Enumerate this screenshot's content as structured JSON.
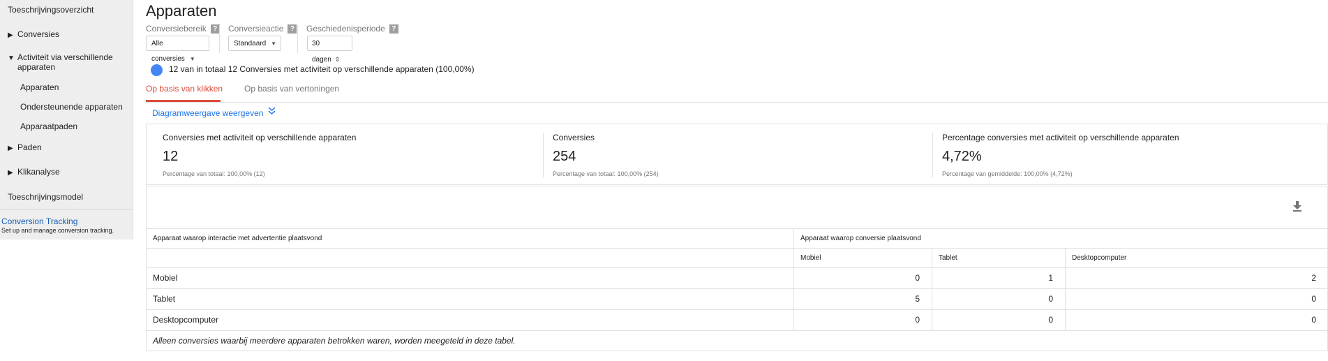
{
  "sidebar": {
    "top_item": "Toeschrijvingsoverzicht",
    "items": [
      {
        "label": "Conversies",
        "expanded": false
      },
      {
        "label": "Activiteit via verschillende apparaten",
        "expanded": true
      },
      {
        "label": "Paden",
        "expanded": false
      },
      {
        "label": "Klikanalyse",
        "expanded": false
      }
    ],
    "subitems": [
      "Apparaten",
      "Ondersteunende apparaten",
      "Apparaatpaden"
    ],
    "activity_line1": "Activiteit via verschillende",
    "activity_line2": "apparaten",
    "bottom_item": "Toeschrijvingsmodel",
    "conversion_tracking_title": "Conversion Tracking",
    "conversion_tracking_sub": "Set up and manage conversion tracking.",
    "collapsed_glyph": "▶",
    "expanded_glyph": "▼"
  },
  "page": {
    "title": "Apparaten"
  },
  "filters": {
    "scope_label": "Conversiebereik",
    "scope_value": "Alle conversies",
    "action_label": "Conversieactie",
    "action_value": "Standaard",
    "period_label": "Geschiedenisperiode",
    "period_value": "30 dagen",
    "help_glyph": "?"
  },
  "info_text": "12 van in totaal 12 Conversies met activiteit op verschillende apparaten (100,00%)",
  "tabs": [
    {
      "label": "Op basis van klikken",
      "active": true
    },
    {
      "label": "Op basis van vertoningen",
      "active": false
    }
  ],
  "diagram_link": "Diagramweergave weergeven",
  "scorecards": [
    {
      "label": "Conversies met activiteit op verschillende apparaten",
      "value": "12",
      "sub": "Percentage van totaal: 100,00% (12)"
    },
    {
      "label": "Conversies",
      "value": "254",
      "sub": "Percentage van totaal: 100,00% (254)"
    },
    {
      "label": "Percentage conversies met activiteit op verschillende apparaten",
      "value": "4,72%",
      "sub": "Percentage van gemiddelde: 100,00% (4,72%)"
    }
  ],
  "table": {
    "row_header": "Apparaat waarop interactie met advertentie plaatsvond",
    "col_group_header": "Apparaat waarop conversie plaatsvond",
    "columns": [
      "Mobiel",
      "Tablet",
      "Desktopcomputer"
    ],
    "rows": [
      {
        "device": "Mobiel",
        "values": [
          "0",
          "1",
          "2"
        ]
      },
      {
        "device": "Tablet",
        "values": [
          "5",
          "0",
          "0"
        ]
      },
      {
        "device": "Desktopcomputer",
        "values": [
          "0",
          "0",
          "0"
        ]
      }
    ],
    "footnote": "Alleen conversies waarbij meerdere apparaten betrokken waren, worden meegeteld in deze tabel."
  },
  "colors": {
    "accent_tab": "#dd4b39",
    "link": "#1a73e8",
    "info_dot": "#4285f4"
  },
  "icons": {
    "download": "download-icon",
    "expand": "double-chevron-down-icon",
    "help": "help-icon"
  }
}
